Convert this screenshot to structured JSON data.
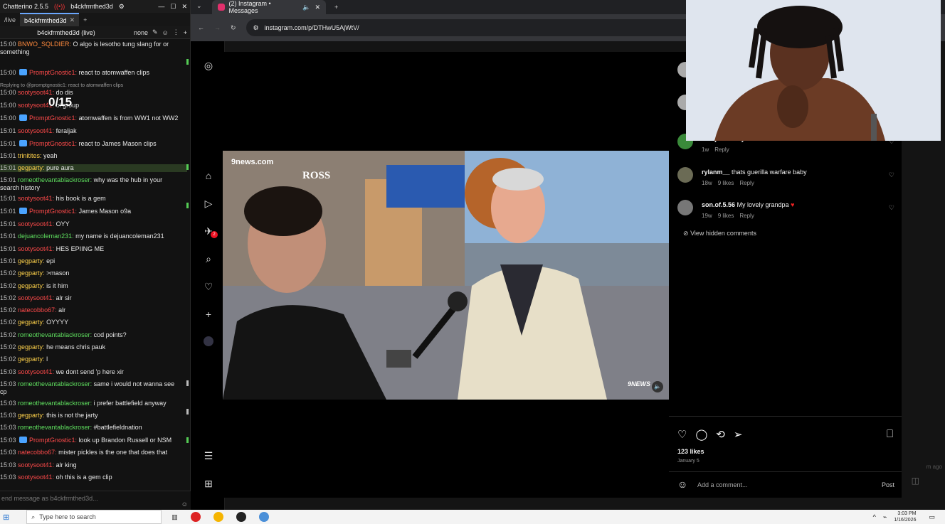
{
  "chatterino": {
    "app_title": "Chatterino 2.5.5",
    "channel_title": "b4ckfrmthed3d",
    "tabs": [
      "/live",
      "b4ckfrmthed3d"
    ],
    "header_title": "b4ckfrmthed3d (live)",
    "header_mode": "none",
    "input_placeholder": "end message as b4ckfrmthed3d...",
    "counter": "0/15",
    "messages": [
      {
        "ts": "15:00",
        "user": "BNWO_SQLDIER:",
        "color": "#ff8a3d",
        "text": "O algo is lesotho tung slang for or something",
        "badge": false
      },
      {
        "ts": "15:00",
        "user": "PromptGnostic1:",
        "color": "#ff4a4a",
        "text": "react to atomwaffen clips",
        "badge": true
      },
      {
        "ts": "",
        "user": "",
        "color": "",
        "text": "Replying to @promptgnostic1: react to atomwaffen clips",
        "badge": false,
        "reply": true
      },
      {
        "ts": "15:00",
        "user": "sootysoot41:",
        "color": "#ff4a4a",
        "text": "do dis",
        "badge": false
      },
      {
        "ts": "15:00",
        "user": "sootysoot41:",
        "color": "#ff4a4a",
        "text": "ol group",
        "badge": false
      },
      {
        "ts": "15:00",
        "user": "PromptGnostic1:",
        "color": "#ff4a4a",
        "text": "atomwaffen is from WW1 not WW2",
        "badge": true
      },
      {
        "ts": "15:01",
        "user": "sootysoot41:",
        "color": "#ff4a4a",
        "text": "feraljak",
        "badge": false
      },
      {
        "ts": "15:01",
        "user": "PromptGnostic1:",
        "color": "#ff4a4a",
        "text": "react to James Mason clips",
        "badge": true
      },
      {
        "ts": "15:01",
        "user": "trinitites:",
        "color": "#ffd24a",
        "text": "yeah",
        "badge": false
      },
      {
        "ts": "15:01",
        "user": "gegparty:",
        "color": "#ffd24a",
        "text": "pure aura",
        "badge": false,
        "hl": true
      },
      {
        "ts": "15:01",
        "user": "romeothevantablackroser:",
        "color": "#5fe05f",
        "text": "why was the hub in your search history",
        "badge": false
      },
      {
        "ts": "15:01",
        "user": "sootysoot41:",
        "color": "#ff4a4a",
        "text": "his book is a gem",
        "badge": false
      },
      {
        "ts": "15:01",
        "user": "PromptGnostic1:",
        "color": "#ff4a4a",
        "text": "James Mason o9a",
        "badge": true
      },
      {
        "ts": "15:01",
        "user": "sootysoot41:",
        "color": "#ff4a4a",
        "text": "OYY",
        "badge": false
      },
      {
        "ts": "15:01",
        "user": "dejuancoleman231:",
        "color": "#5fe05f",
        "text": "my name is dejuancoleman231",
        "badge": false
      },
      {
        "ts": "15:01",
        "user": "sootysoot41:",
        "color": "#ff4a4a",
        "text": "HES EPIING ME",
        "badge": false
      },
      {
        "ts": "15:01",
        "user": "gegparty:",
        "color": "#ffd24a",
        "text": "epi",
        "badge": false
      },
      {
        "ts": "15:02",
        "user": "gegparty:",
        "color": "#ffd24a",
        "text": ">mason",
        "badge": false
      },
      {
        "ts": "15:02",
        "user": "gegparty:",
        "color": "#ffd24a",
        "text": "is it him",
        "badge": false
      },
      {
        "ts": "15:02",
        "user": "sootysoot41:",
        "color": "#ff4a4a",
        "text": "alr sir",
        "badge": false
      },
      {
        "ts": "15:02",
        "user": "natecobbo67:",
        "color": "#ff4a4a",
        "text": "alr",
        "badge": false
      },
      {
        "ts": "15:02",
        "user": "gegparty:",
        "color": "#ffd24a",
        "text": "OYYYY",
        "badge": false
      },
      {
        "ts": "15:02",
        "user": "romeothevantablackroser:",
        "color": "#5fe05f",
        "text": "cod points?",
        "badge": false
      },
      {
        "ts": "15:02",
        "user": "gegparty:",
        "color": "#ffd24a",
        "text": "he means chris pauk",
        "badge": false
      },
      {
        "ts": "15:02",
        "user": "gegparty:",
        "color": "#ffd24a",
        "text": "l",
        "badge": false
      },
      {
        "ts": "15:03",
        "user": "sootysoot41:",
        "color": "#ff4a4a",
        "text": "we dont send 'p here xir",
        "badge": false
      },
      {
        "ts": "15:03",
        "user": "romeothevantablackroser:",
        "color": "#5fe05f",
        "text": "same i would not wanna see cp",
        "badge": false
      },
      {
        "ts": "15:03",
        "user": "romeothevantablackroser:",
        "color": "#5fe05f",
        "text": "i prefer battlefield anyway",
        "badge": false
      },
      {
        "ts": "15:03",
        "user": "gegparty:",
        "color": "#ffd24a",
        "text": "this is not the jarty",
        "badge": false
      },
      {
        "ts": "15:03",
        "user": "romeothevantablackroser:",
        "color": "#5fe05f",
        "text": "#battlefieldnation",
        "badge": false
      },
      {
        "ts": "15:03",
        "user": "PromptGnostic1:",
        "color": "#ff4a4a",
        "text": "look up Brandon Russell or NSM",
        "badge": true
      },
      {
        "ts": "15:03",
        "user": "natecobbo67:",
        "color": "#ff4a4a",
        "text": "mister pickles is the one that does that",
        "badge": false
      },
      {
        "ts": "15:03",
        "user": "sootysoot41:",
        "color": "#ff4a4a",
        "text": "alr king",
        "badge": false
      },
      {
        "ts": "15:03",
        "user": "sootysoot41:",
        "color": "#ff4a4a",
        "text": "oh this is a gem clip",
        "badge": false
      }
    ]
  },
  "browser": {
    "tab_title": "(2) Instagram • Messages",
    "url": "instagram.com/p/DTHwU5AjWtV/"
  },
  "video": {
    "watermark": "9news.com",
    "store_sign": "ROSS",
    "corner_logo": "9NEWS"
  },
  "instagram": {
    "comments": [
      {
        "user": "souljsterritory",
        "text": "W Mason",
        "time": "1w",
        "likes": "",
        "reply": "Reply"
      },
      {
        "user": "rylanm__",
        "text": "thats guerilla warfare baby",
        "time": "18w",
        "likes": "9 likes",
        "reply": "Reply"
      },
      {
        "user": "son.of.5.56",
        "text": "My lovely grandpa",
        "time": "19w",
        "likes": "9 likes",
        "reply": "Reply"
      }
    ],
    "hidden_comments": "View hidden comments",
    "likes": "123 likes",
    "date": "January 5",
    "comment_placeholder": "Add a comment...",
    "post_button": "Post",
    "side_time": "m ago"
  },
  "taskbar": {
    "search_placeholder": "Type here to search",
    "time": "3:03 PM",
    "date": "1/16/2026"
  }
}
